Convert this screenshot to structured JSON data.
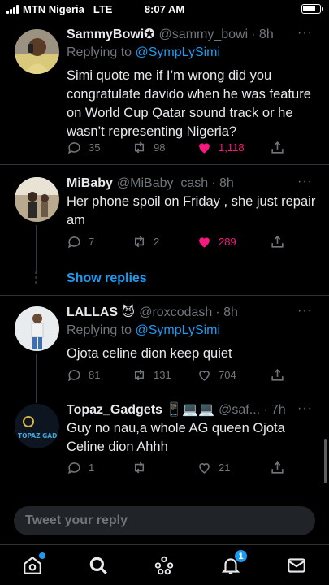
{
  "status_bar": {
    "carrier": "MTN Nigeria",
    "network": "LTE",
    "time": "8:07 AM",
    "battery_level": 0.8
  },
  "tweets": [
    {
      "name": "SammyBowi✪",
      "handle": "@sammy_bowi",
      "time": "· 8h",
      "replying_prefix": "Replying to",
      "replying_to": "@SympLySimi",
      "text": "Simi quote me if I’m wrong did you congratulate davido when he was feature on World Cup Qatar sound track or he wasn’t representing Nigeria?",
      "replies": "35",
      "retweets": "98",
      "likes": "1,118",
      "liked": true
    },
    {
      "name": "MiBaby",
      "handle": "@MiBaby_cash",
      "time": "· 8h",
      "text": "Her phone spoil on Friday , she just repair am",
      "replies": "7",
      "retweets": "2",
      "likes": "289",
      "liked": true
    },
    {
      "name": "LALLAS 😈",
      "handle": "@roxcodash",
      "time": "· 8h",
      "replying_prefix": "Replying to",
      "replying_to": "@SympLySimi",
      "text": "Ojota celine dion keep quiet",
      "replies": "81",
      "retweets": "131",
      "likes": "704",
      "liked": false
    },
    {
      "name": "Topaz_Gadgets 📱💻💻",
      "handle": "@saf...",
      "time": "· 7h",
      "avatar_text": "TOPAZ GADGETS",
      "text": "Guy no nau,a whole AG queen Ojota Celine dion Ahhh",
      "replies": "1",
      "retweets": "",
      "likes": "21",
      "liked": false
    }
  ],
  "show_replies": "Show replies",
  "reply_placeholder": "Tweet your reply",
  "more_glyph": "···",
  "tabbar": {
    "notifications_count": "1"
  },
  "colors": {
    "accent": "#1d9bf0",
    "like": "#f91880",
    "muted": "#71767b"
  }
}
